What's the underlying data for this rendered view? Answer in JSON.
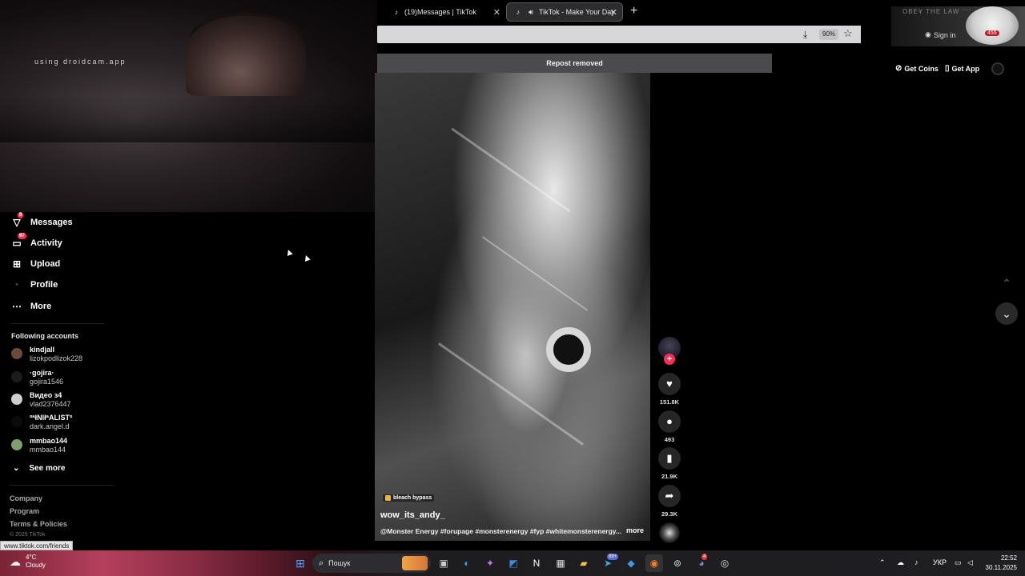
{
  "webcam": {
    "watermark": "using droidcam.app"
  },
  "browser": {
    "tabs": [
      {
        "label": "(19)Messages | TikTok",
        "icon": "tiktok-icon",
        "active": false
      },
      {
        "label": "TikTok - Make Your Day",
        "icon": "tiktok-icon",
        "active": true,
        "audio": true
      }
    ],
    "zoom": "90%",
    "signin": "Sign in",
    "header_art_text": "OBEY THE LAW",
    "header_badge": "455",
    "status_url": "www.tiktok.com/friends"
  },
  "banner": {
    "text": "Repost removed"
  },
  "header_buttons": {
    "coins": "Get Coins",
    "app": "Get App"
  },
  "sidebar": {
    "nav": [
      {
        "label": "Messages",
        "icon": "paper-plane-icon",
        "badge": "9"
      },
      {
        "label": "Activity",
        "icon": "inbox-icon",
        "badge": "97"
      },
      {
        "label": "Upload",
        "icon": "plus-square-icon",
        "badge": ""
      },
      {
        "label": "Profile",
        "icon": "profile-icon",
        "badge": ""
      },
      {
        "label": "More",
        "icon": "more-dots-icon",
        "badge": ""
      }
    ],
    "following_title": "Following accounts",
    "accounts": [
      {
        "name": "kindjall",
        "handle": "lizokpodlizok228",
        "color": "#6b4a3a"
      },
      {
        "name": "·gojira·",
        "handle": "gojira1546",
        "color": "#1b1b1b"
      },
      {
        "name": "Видео з4",
        "handle": "vlad2376447",
        "color": "#cfcfcf"
      },
      {
        "name": "ºªłNIłªALISTº",
        "handle": "dark.angel.d",
        "color": "#0b0b0b"
      },
      {
        "name": "mmbao144",
        "handle": "mmbao144",
        "color": "#7e9e6e"
      }
    ],
    "see_more": "See more",
    "footer": {
      "company": "Company",
      "program": "Program",
      "terms": "Terms & Policies",
      "copyright": "© 2025 TikTok"
    }
  },
  "video": {
    "filter": "bleach bypass",
    "author": "wow_its_andy_",
    "description": "@Monster Energy #forupage #monsterenergy #fyp #whitemonsterenergy...",
    "more": "more",
    "likes": "151.8K",
    "comments": "493",
    "saves": "21.9K",
    "shares": "29.3K"
  },
  "taskbar": {
    "weather_temp": "4°C",
    "weather_desc": "Cloudy",
    "search_placeholder": "Пошук",
    "lang": "УКР",
    "time": "22:52",
    "date": "30.11.2025",
    "telegram_badge": "99+",
    "discord_badge": "4"
  },
  "colors": {
    "accent": "#fe2c55",
    "background": "#000000"
  }
}
